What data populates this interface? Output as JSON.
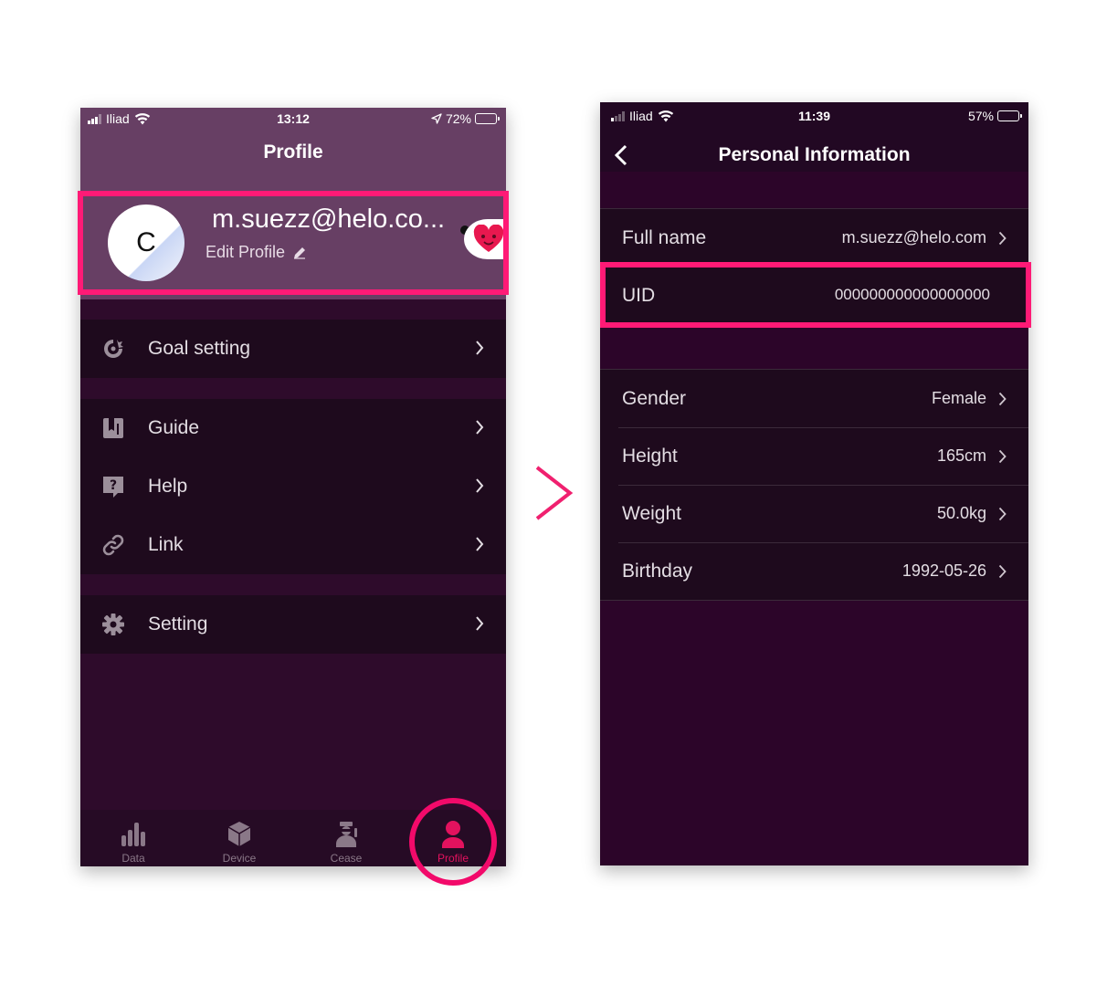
{
  "colors": {
    "accent": "#ff1a76",
    "tab_active": "#e3125e",
    "header_purple": "#673f64",
    "background_dark": "#2e0b2b",
    "row_dark": "#1e0a1d"
  },
  "left_screen": {
    "status": {
      "carrier": "Iliad",
      "time": "13:12",
      "battery": "72%"
    },
    "title": "Profile",
    "profile": {
      "avatar_letter": "C",
      "email": "m.suezz@helo.co...",
      "edit_label": "Edit Profile",
      "edit_icon": "pencil-icon"
    },
    "menu_groups": [
      [
        {
          "label": "Goal setting",
          "icon": "goal-icon"
        }
      ],
      [
        {
          "label": "Guide",
          "icon": "guide-book-icon"
        },
        {
          "label": "Help",
          "icon": "help-icon"
        },
        {
          "label": "Link",
          "icon": "link-icon"
        }
      ],
      [
        {
          "label": "Setting",
          "icon": "gear-icon"
        }
      ]
    ],
    "tabs": [
      {
        "label": "Data",
        "icon": "bar-chart-icon",
        "active": false
      },
      {
        "label": "Device",
        "icon": "cube-icon",
        "active": false
      },
      {
        "label": "Cease",
        "icon": "doctor-icon",
        "active": false
      },
      {
        "label": "Profile",
        "icon": "person-icon",
        "active": true
      }
    ]
  },
  "right_screen": {
    "status": {
      "carrier": "Iliad",
      "time": "11:39",
      "battery": "57%"
    },
    "title": "Personal Information",
    "groups": [
      [
        {
          "label": "Full name",
          "value": "m.suezz@helo.com",
          "chevron": true
        },
        {
          "label": "UID",
          "value": "000000000000000000",
          "chevron": false
        }
      ],
      [
        {
          "label": "Gender",
          "value": "Female",
          "chevron": true
        },
        {
          "label": "Height",
          "value": "165cm",
          "chevron": true
        },
        {
          "label": "Weight",
          "value": "50.0kg",
          "chevron": true
        },
        {
          "label": "Birthday",
          "value": "1992-05-26",
          "chevron": true
        }
      ]
    ]
  }
}
